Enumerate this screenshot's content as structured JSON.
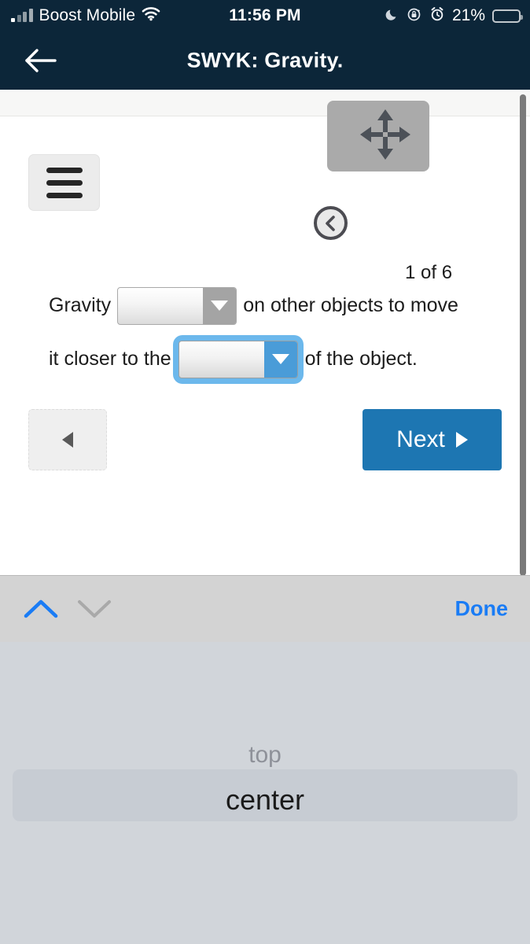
{
  "status_bar": {
    "carrier": "Boost Mobile",
    "time": "11:56 PM",
    "battery_percent": "21%",
    "icons": [
      "signal-bars-icon",
      "wifi-icon",
      "moon-icon",
      "rotation-lock-icon",
      "alarm-clock-icon",
      "battery-icon"
    ],
    "battery_fill_color": "#f7cf24",
    "bar_background": "#0c2639"
  },
  "nav_bar": {
    "back_label": "back-arrow",
    "title": "SWYK: Gravity."
  },
  "content": {
    "menu_button_label": "menu",
    "move_widget_label": "move",
    "collapse_button_label": "collapse",
    "page_count": "1 of 6",
    "sentence": {
      "part1": "Gravity",
      "dropdown1_value": "",
      "part2": "on other objects to move",
      "part3": "it closer to the",
      "dropdown2_value": "",
      "part4": "of the object."
    },
    "prev_button_label": "",
    "next_button_label": "Next",
    "next_button_color": "#1d76b2"
  },
  "accessory_bar": {
    "up_label": "previous-field",
    "down_label": "next-field",
    "done_label": "Done",
    "done_color": "#1a7cf5",
    "up_enabled_color": "#1a7cf5",
    "down_disabled_color": "#a9a9a9"
  },
  "picker": {
    "options": [
      "top",
      "center"
    ],
    "above_value": "top",
    "selected_value": "center",
    "selection_band_color": "#c7ccd3",
    "background_color": "#d1d5da"
  }
}
